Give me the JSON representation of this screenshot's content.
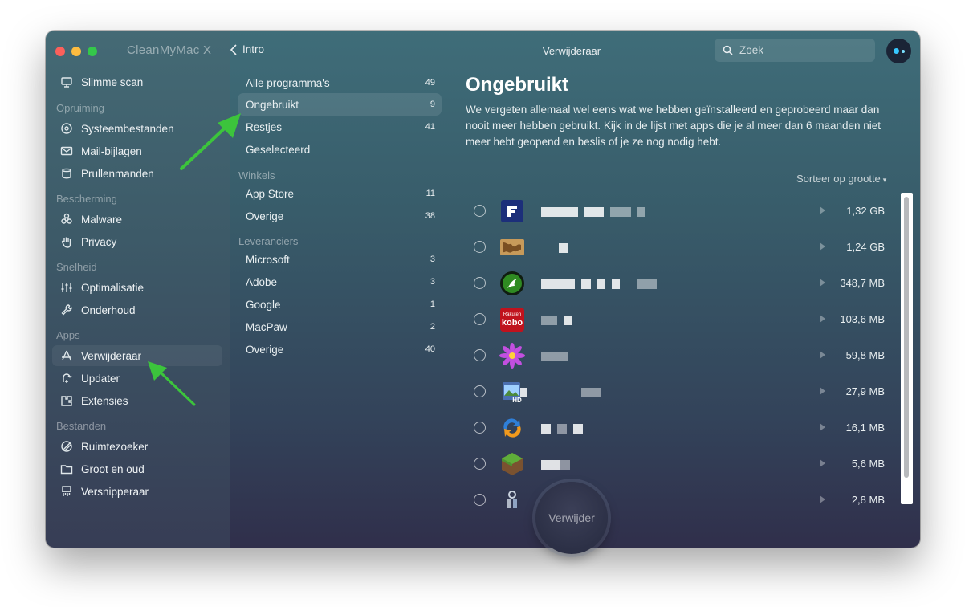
{
  "app": {
    "title": "CleanMyMac X",
    "window_title": "Verwijderaar",
    "back_label": "Intro"
  },
  "search": {
    "placeholder": "Zoek"
  },
  "sidebar": {
    "top_item": {
      "label": "Slimme scan",
      "icon": "smart-scan-icon"
    },
    "sections": [
      {
        "header": "Opruiming",
        "items": [
          {
            "label": "Systeembestanden",
            "icon": "system-junk-icon"
          },
          {
            "label": "Mail-bijlagen",
            "icon": "mail-icon"
          },
          {
            "label": "Prullenmanden",
            "icon": "trash-icon"
          }
        ]
      },
      {
        "header": "Bescherming",
        "items": [
          {
            "label": "Malware",
            "icon": "biohazard-icon"
          },
          {
            "label": "Privacy",
            "icon": "hand-icon"
          }
        ]
      },
      {
        "header": "Snelheid",
        "items": [
          {
            "label": "Optimalisatie",
            "icon": "sliders-icon"
          },
          {
            "label": "Onderhoud",
            "icon": "wrench-icon"
          }
        ]
      },
      {
        "header": "Apps",
        "items": [
          {
            "label": "Verwijderaar",
            "icon": "uninstaller-icon",
            "active": true
          },
          {
            "label": "Updater",
            "icon": "updater-icon"
          },
          {
            "label": "Extensies",
            "icon": "extensions-icon"
          }
        ]
      },
      {
        "header": "Bestanden",
        "items": [
          {
            "label": "Ruimtezoeker",
            "icon": "space-lens-icon"
          },
          {
            "label": "Groot en oud",
            "icon": "folder-icon"
          },
          {
            "label": "Versnipperaar",
            "icon": "shredder-icon"
          }
        ]
      }
    ]
  },
  "filters": {
    "top": [
      {
        "label": "Alle programma's",
        "count": "49"
      },
      {
        "label": "Ongebruikt",
        "count": "9",
        "active": true
      },
      {
        "label": "Restjes",
        "count": "41"
      },
      {
        "label": "Geselecteerd",
        "count": ""
      }
    ],
    "winkels": {
      "header": "Winkels",
      "items": [
        {
          "label": "App Store",
          "count": "11"
        },
        {
          "label": "Overige",
          "count": "38"
        }
      ]
    },
    "leveranciers": {
      "header": "Leveranciers",
      "items": [
        {
          "label": "Microsoft",
          "count": "3"
        },
        {
          "label": "Adobe",
          "count": "3"
        },
        {
          "label": "Google",
          "count": "1"
        },
        {
          "label": "MacPaw",
          "count": "2"
        },
        {
          "label": "Overige",
          "count": "40"
        }
      ]
    }
  },
  "content": {
    "title": "Ongebruikt",
    "description": "We vergeten allemaal wel eens wat we hebben geïnstalleerd en geprobeerd maar dan nooit meer hebben gebruikt. Kijk in de lijst met apps die je al meer dan 6 maanden niet meer hebt geopend en beslis of je ze nog nodig hebt.",
    "sort_label": "Sorteer op grootte"
  },
  "apps": [
    {
      "size": "1,32 GB",
      "icon": "blue-app-icon"
    },
    {
      "size": "1,24 GB",
      "icon": "world-map-icon"
    },
    {
      "size": "348,7 MB",
      "icon": "gecko-icon"
    },
    {
      "size": "103,6 MB",
      "icon": "kobo-icon",
      "icon_text_1": "Rakuten",
      "icon_text_2": "kobo"
    },
    {
      "size": "59,8 MB",
      "icon": "flower-icon"
    },
    {
      "size": "27,9 MB",
      "icon": "photo-hd-icon",
      "icon_text_1": "HD"
    },
    {
      "size": "16,1 MB",
      "icon": "sync-arrows-icon"
    },
    {
      "size": "5,6 MB",
      "icon": "grass-block-icon"
    },
    {
      "size": "2,8 MB",
      "icon": "keychain-icon"
    }
  ],
  "actions": {
    "remove_label": "Verwijder"
  },
  "colors": {
    "annotation_arrow": "#3cc43c",
    "scan_accent": "#37c8ff"
  }
}
